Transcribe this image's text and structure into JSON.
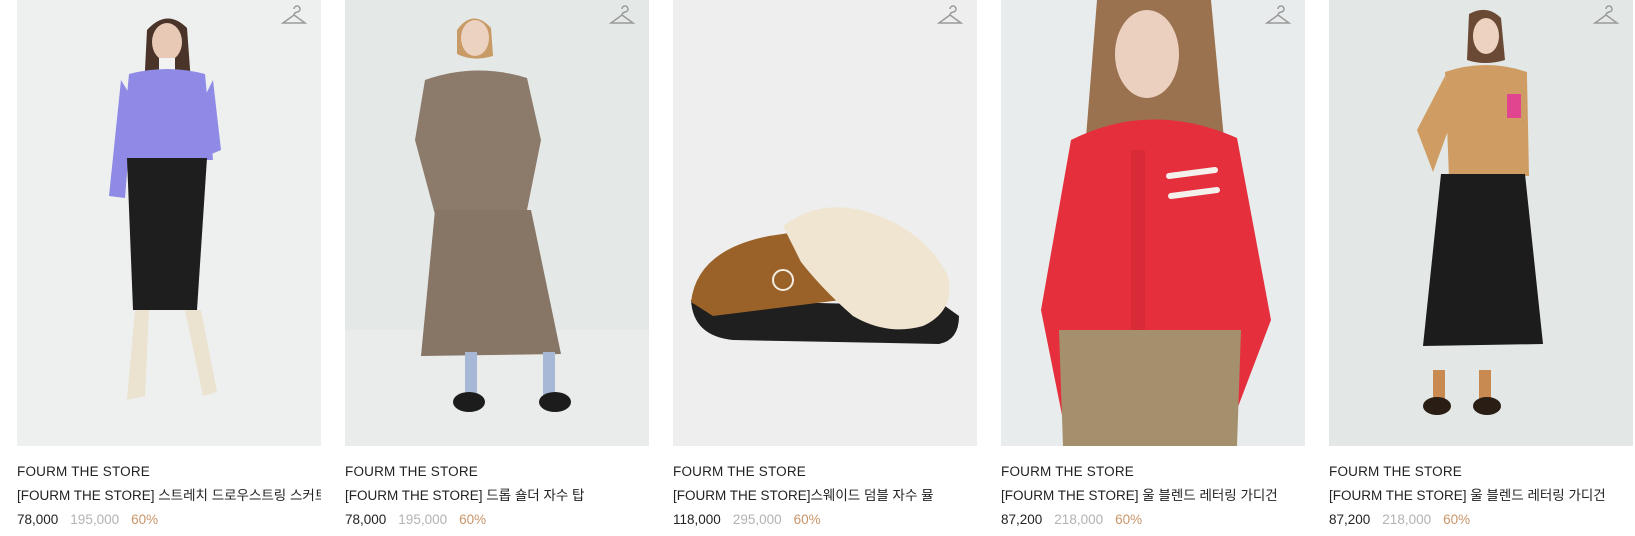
{
  "products": [
    {
      "brand": "FOURM THE STORE",
      "title": "[FOURM THE STORE] 스트레치 드로우스트링 스커트",
      "price": "78,000",
      "original_price": "195,000",
      "discount": "60%",
      "image": "model-lavender-cardigan-black-skirt",
      "bg": "#eef0f0"
    },
    {
      "brand": "FOURM THE STORE",
      "title": "[FOURM THE STORE] 드롭 숄더 자수 탑",
      "price": "78,000",
      "original_price": "195,000",
      "discount": "60%",
      "image": "model-taupe-sweatshirt-skirt",
      "bg": "#e4e9e8"
    },
    {
      "brand": "FOURM THE STORE",
      "title": "[FOURM THE STORE]스웨이드 덤블 자수 뮬",
      "price": "118,000",
      "original_price": "295,000",
      "discount": "60%",
      "image": "suede-shearling-mule",
      "bg": "#eeeeee"
    },
    {
      "brand": "FOURM THE STORE",
      "title": "[FOURM THE STORE] 울 블렌드 레터링 가디건",
      "price": "87,200",
      "original_price": "218,000",
      "discount": "60%",
      "image": "model-red-lettering-cardigan",
      "bg": "#e8ecec"
    },
    {
      "brand": "FOURM THE STORE",
      "title": "[FOURM THE STORE] 울 블렌드 레터링 가디건",
      "price": "87,200",
      "original_price": "218,000",
      "discount": "60%",
      "image": "model-camel-cardigan-quilted-skirt",
      "bg": "#e3e8e6"
    }
  ],
  "icons": {
    "wishlist": "hanger-icon"
  }
}
